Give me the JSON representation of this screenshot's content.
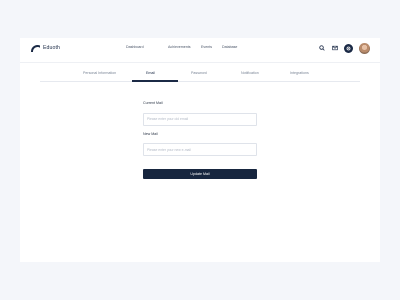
{
  "app": {
    "brand": "Eduoth"
  },
  "nav": {
    "items": [
      {
        "label": "Dashboard"
      },
      {
        "label": "Achievements"
      },
      {
        "label": "Events"
      },
      {
        "label": "Database"
      }
    ]
  },
  "header_icons": {
    "search": "search-icon",
    "mail": "mail-icon",
    "settings": "gear-icon",
    "avatar": "user-avatar"
  },
  "tabs": [
    {
      "label": "Personal Information"
    },
    {
      "label": "Email",
      "active": true
    },
    {
      "label": "Password"
    },
    {
      "label": "Notification"
    },
    {
      "label": "Integrations"
    }
  ],
  "form": {
    "current_mail_label": "Current Mail",
    "current_mail_placeholder": "Please enter your old email",
    "new_mail_label": "New Mail",
    "new_mail_placeholder": "Please enter your new e-mail",
    "submit_label": "Update Mail"
  },
  "colors": {
    "accent": "#17263f",
    "background": "#f4f6fa",
    "card": "#ffffff"
  }
}
